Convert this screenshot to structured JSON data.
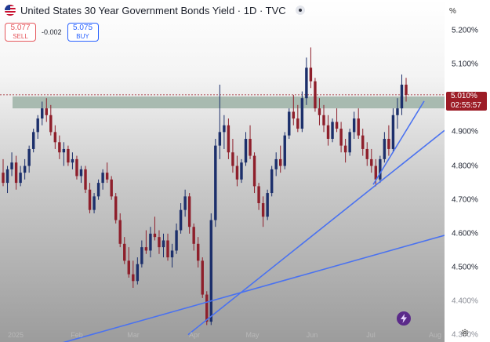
{
  "header": {
    "title": "United States 30 Year Government Bonds Yield · 1D · TVC",
    "sell_price": "5.077",
    "sell_label": "SELL",
    "spread": "-0.002",
    "buy_price": "5.075",
    "buy_label": "BUY"
  },
  "axis": {
    "unit": "%",
    "current_price": "5.010%",
    "countdown": "02:55:57",
    "ticks": [
      "5.200%",
      "5.100%",
      "5.000%",
      "4.900%",
      "4.800%",
      "4.700%",
      "4.600%",
      "4.500%",
      "4.400%",
      "4.300%"
    ]
  },
  "time_axis": [
    "2025",
    "Feb",
    "Mar",
    "Apr",
    "May",
    "Jun",
    "Jul",
    "Aug"
  ],
  "colors": {
    "up": "#1c2f6b",
    "down": "#8e1f2b",
    "trendline": "#4a72f0",
    "zone": "#8fa89a",
    "price_tag": "#9c1c26"
  },
  "chart_data": {
    "type": "candlestick",
    "title": "United States 30 Year Government Bonds Yield · 1D · TVC",
    "ylabel": "%",
    "ylim": [
      4.28,
      5.29
    ],
    "x_ticks": [
      "2025",
      "Feb",
      "Mar",
      "Apr",
      "May",
      "Jun",
      "Jul",
      "Aug"
    ],
    "series": [
      {
        "values": [
          [
            4.78,
            4.82,
            4.74,
            4.75
          ],
          [
            4.75,
            4.8,
            4.72,
            4.79
          ],
          [
            4.79,
            4.84,
            4.77,
            4.81
          ],
          [
            4.81,
            4.83,
            4.73,
            4.75
          ],
          [
            4.75,
            4.8,
            4.74,
            4.78
          ],
          [
            4.78,
            4.82,
            4.76,
            4.8
          ],
          [
            4.8,
            4.86,
            4.78,
            4.85
          ],
          [
            4.85,
            4.91,
            4.84,
            4.9
          ],
          [
            4.9,
            4.95,
            4.88,
            4.94
          ],
          [
            4.94,
            4.99,
            4.92,
            4.97
          ],
          [
            4.97,
            5.0,
            4.93,
            4.95
          ],
          [
            4.95,
            4.98,
            4.89,
            4.9
          ],
          [
            4.9,
            4.92,
            4.85,
            4.87
          ],
          [
            4.87,
            4.89,
            4.82,
            4.84
          ],
          [
            4.84,
            4.87,
            4.8,
            4.85
          ],
          [
            4.85,
            4.86,
            4.8,
            4.81
          ],
          [
            4.81,
            4.84,
            4.79,
            4.82
          ],
          [
            4.82,
            4.83,
            4.76,
            4.77
          ],
          [
            4.77,
            4.8,
            4.75,
            4.79
          ],
          [
            4.79,
            4.8,
            4.72,
            4.73
          ],
          [
            4.73,
            4.75,
            4.66,
            4.67
          ],
          [
            4.67,
            4.72,
            4.66,
            4.71
          ],
          [
            4.71,
            4.76,
            4.7,
            4.75
          ],
          [
            4.75,
            4.79,
            4.73,
            4.78
          ],
          [
            4.78,
            4.81,
            4.75,
            4.76
          ],
          [
            4.76,
            4.77,
            4.7,
            4.71
          ],
          [
            4.71,
            4.72,
            4.63,
            4.64
          ],
          [
            4.64,
            4.66,
            4.56,
            4.57
          ],
          [
            4.57,
            4.59,
            4.51,
            4.52
          ],
          [
            4.52,
            4.56,
            4.47,
            4.48
          ],
          [
            4.48,
            4.52,
            4.44,
            4.46
          ],
          [
            4.46,
            4.53,
            4.45,
            4.51
          ],
          [
            4.51,
            4.58,
            4.5,
            4.56
          ],
          [
            4.56,
            4.61,
            4.54,
            4.55
          ],
          [
            4.55,
            4.62,
            4.53,
            4.6
          ],
          [
            4.6,
            4.65,
            4.58,
            4.59
          ],
          [
            4.59,
            4.61,
            4.54,
            4.56
          ],
          [
            4.56,
            4.6,
            4.53,
            4.58
          ],
          [
            4.58,
            4.6,
            4.52,
            4.53
          ],
          [
            4.53,
            4.57,
            4.5,
            4.55
          ],
          [
            4.55,
            4.63,
            4.54,
            4.61
          ],
          [
            4.61,
            4.69,
            4.6,
            4.67
          ],
          [
            4.67,
            4.73,
            4.65,
            4.71
          ],
          [
            4.71,
            4.72,
            4.6,
            4.62
          ],
          [
            4.62,
            4.63,
            4.55,
            4.57
          ],
          [
            4.57,
            4.59,
            4.5,
            4.52
          ],
          [
            4.52,
            4.53,
            4.41,
            4.42
          ],
          [
            4.42,
            4.43,
            4.33,
            4.34
          ],
          [
            4.34,
            4.66,
            4.33,
            4.64
          ],
          [
            4.64,
            4.88,
            4.62,
            4.86
          ],
          [
            4.86,
            5.04,
            4.82,
            4.9
          ],
          [
            4.9,
            4.95,
            4.85,
            4.92
          ],
          [
            4.92,
            4.94,
            4.82,
            4.84
          ],
          [
            4.84,
            4.88,
            4.78,
            4.8
          ],
          [
            4.8,
            4.83,
            4.74,
            4.76
          ],
          [
            4.76,
            4.82,
            4.75,
            4.81
          ],
          [
            4.81,
            4.9,
            4.8,
            4.88
          ],
          [
            4.88,
            4.92,
            4.82,
            4.83
          ],
          [
            4.83,
            4.84,
            4.72,
            4.74
          ],
          [
            4.74,
            4.75,
            4.67,
            4.69
          ],
          [
            4.69,
            4.71,
            4.62,
            4.65
          ],
          [
            4.65,
            4.73,
            4.64,
            4.72
          ],
          [
            4.72,
            4.8,
            4.71,
            4.79
          ],
          [
            4.79,
            4.84,
            4.77,
            4.82
          ],
          [
            4.82,
            4.86,
            4.78,
            4.8
          ],
          [
            4.8,
            4.9,
            4.79,
            4.89
          ],
          [
            4.89,
            4.97,
            4.88,
            4.96
          ],
          [
            4.96,
            5.01,
            4.92,
            4.94
          ],
          [
            4.94,
            4.98,
            4.9,
            4.91
          ],
          [
            4.91,
            5.02,
            4.9,
            5.0
          ],
          [
            5.0,
            5.12,
            4.98,
            5.09
          ],
          [
            5.09,
            5.15,
            5.03,
            5.05
          ],
          [
            5.05,
            5.06,
            4.96,
            4.97
          ],
          [
            4.97,
            5.0,
            4.92,
            4.95
          ],
          [
            4.95,
            4.98,
            4.9,
            4.92
          ],
          [
            4.92,
            4.95,
            4.86,
            4.88
          ],
          [
            4.88,
            4.94,
            4.87,
            4.93
          ],
          [
            4.93,
            4.97,
            4.9,
            4.91
          ],
          [
            4.91,
            4.93,
            4.84,
            4.86
          ],
          [
            4.86,
            4.88,
            4.81,
            4.84
          ],
          [
            4.84,
            4.91,
            4.83,
            4.9
          ],
          [
            4.9,
            4.96,
            4.88,
            4.94
          ],
          [
            4.94,
            4.97,
            4.88,
            4.89
          ],
          [
            4.89,
            4.91,
            4.83,
            4.85
          ],
          [
            4.85,
            4.87,
            4.8,
            4.82
          ],
          [
            4.82,
            4.85,
            4.78,
            4.8
          ],
          [
            4.8,
            4.82,
            4.74,
            4.76
          ],
          [
            4.76,
            4.83,
            4.75,
            4.82
          ],
          [
            4.82,
            4.9,
            4.81,
            4.88
          ],
          [
            4.88,
            4.92,
            4.83,
            4.85
          ],
          [
            4.85,
            4.97,
            4.84,
            4.95
          ],
          [
            4.95,
            5.0,
            4.91,
            4.97
          ],
          [
            4.97,
            5.07,
            4.95,
            5.04
          ],
          [
            5.04,
            5.06,
            4.99,
            5.01
          ]
        ]
      }
    ],
    "horizontal_zone": [
      4.97,
      5.005
    ],
    "current_price_line": 5.01,
    "trendlines": [
      {
        "from": {
          "x": "2025",
          "y": 4.265
        },
        "to": {
          "x": "Aug",
          "y": 4.595
        }
      },
      {
        "from": {
          "x": "Apr",
          "y": 4.335
        },
        "to": {
          "x": "Aug",
          "y": 4.905
        }
      },
      {
        "from": {
          "x": "Jul",
          "y": 4.745
        },
        "to": {
          "x": "Aug",
          "y": 5.09
        }
      }
    ]
  }
}
